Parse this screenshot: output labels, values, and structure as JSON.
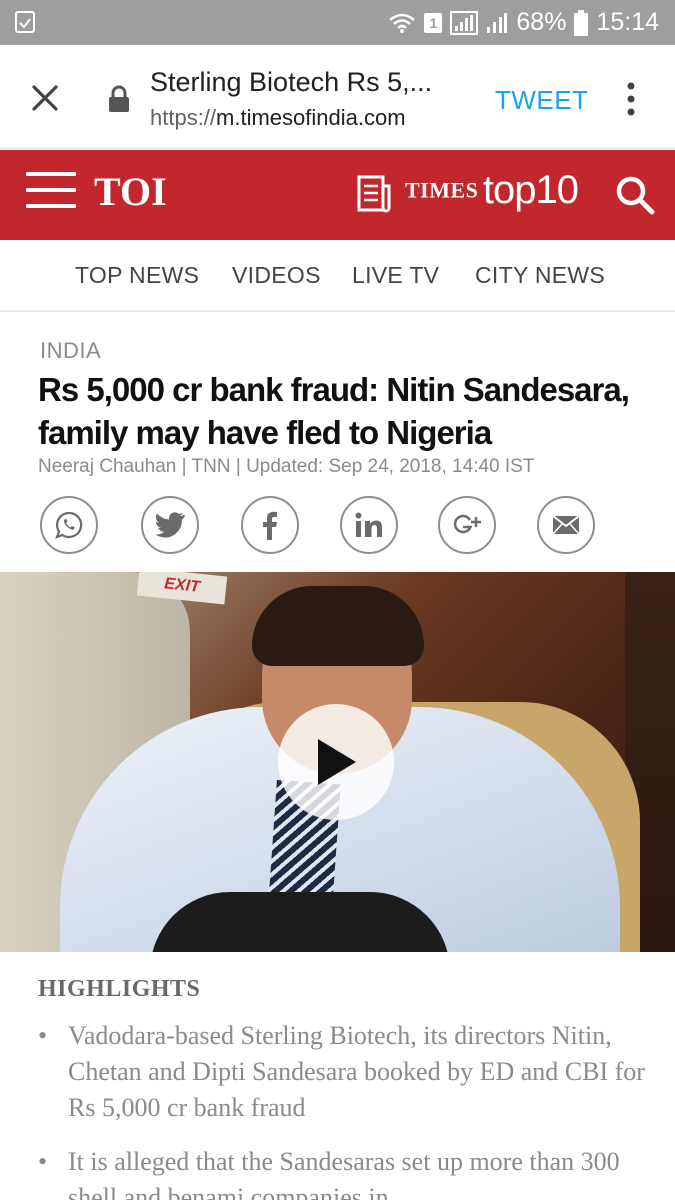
{
  "status_bar": {
    "battery": "68%",
    "time": "15:14",
    "sim": "1"
  },
  "browser": {
    "title": "Sterling Biotech Rs 5,...",
    "url_scheme": "https://",
    "url_host": "m.timesofindia.com",
    "tweet_label": "TWEET"
  },
  "header": {
    "logo": "TOI",
    "times": "TIMES",
    "top10": "top10",
    "accent_color": "#c1272d"
  },
  "nav": {
    "tabs": [
      {
        "label": "TOP NEWS"
      },
      {
        "label": "VIDEOS"
      },
      {
        "label": "LIVE TV"
      },
      {
        "label": "CITY NEWS"
      }
    ]
  },
  "article": {
    "section": "INDIA",
    "headline": "Rs 5,000 cr bank fraud: Nitin Sandesara, family may have fled to Nigeria",
    "byline": "Neeraj Chauhan | TNN | Updated: Sep 24, 2018, 14:40 IST",
    "video_sign": "EXIT",
    "share_icons": [
      "whatsapp-icon",
      "twitter-icon",
      "facebook-icon",
      "linkedin-icon",
      "google-plus-icon",
      "email-icon"
    ]
  },
  "highlights": {
    "title": "HIGHLIGHTS",
    "items": [
      "Vadodara-based Sterling Biotech, its directors Nitin, Chetan and Dipti Sandesara booked by ED and CBI for Rs 5,000 cr bank fraud",
      "It is alleged that the Sandesaras set up more than 300 shell and benami companies in"
    ]
  }
}
